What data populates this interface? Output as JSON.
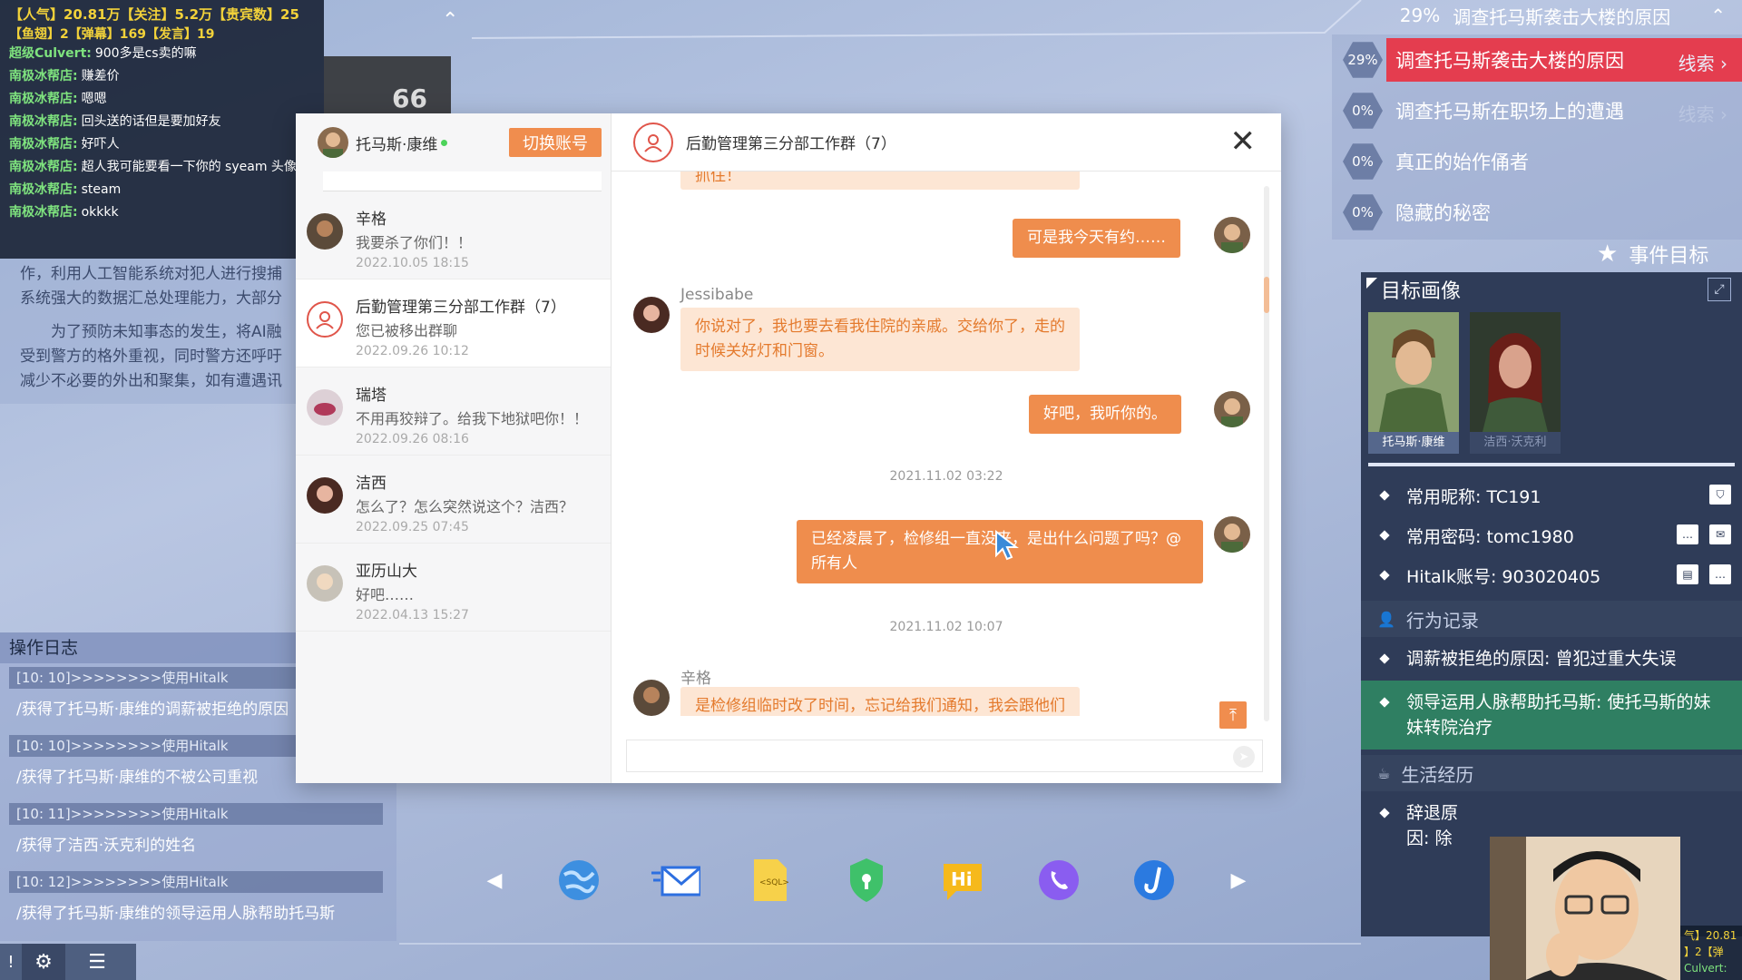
{
  "stream": {
    "stat_line_1": "【人气】20.81万【关注】5.2万【贵宾数】25",
    "stat_line_2": "【鱼翅】2【弹幕】169【发言】19",
    "messages": [
      {
        "user": "超级Culvert:",
        "text": "900多是cs卖的嘛"
      },
      {
        "user": "南极冰帮店:",
        "text": "赚差价"
      },
      {
        "user": "南极冰帮店:",
        "text": "嗯嗯"
      },
      {
        "user": "南极冰帮店:",
        "text": "回头送的话但是要加好友"
      },
      {
        "user": "南极冰帮店:",
        "text": "好吓人"
      },
      {
        "user": "南极冰帮店:",
        "text": "超人我可能要看一下你的 syeam 头像"
      },
      {
        "user": "南极冰帮店:",
        "text": "steam"
      },
      {
        "user": "南极冰帮店:",
        "text": "okkkk"
      }
    ]
  },
  "left_doc": {
    "p1": "作，利用人工智能系统对犯人进行搜捕系统强大的数据汇总处理能力，大部分",
    "p2": "为了预防未知事态的发生，将AI融受到警方的格外重视，同时警方还呼吁减少不必要的外出和聚集，如有遭遇讯"
  },
  "oplog": {
    "title": "操作日志",
    "entries": [
      {
        "time": "[10: 10]>>>>>>>>使用Hitalk",
        "text": "/获得了托马斯·康维的调薪被拒绝的原因"
      },
      {
        "time": "[10: 10]>>>>>>>>使用Hitalk",
        "text": "/获得了托马斯·康维的不被公司重视"
      },
      {
        "time": "[10: 11]>>>>>>>>使用Hitalk",
        "text": "/获得了洁西·沃克利的姓名"
      },
      {
        "time": "[10: 12]>>>>>>>>使用Hitalk",
        "text": "/获得了托马斯·康维的领导运用人脉帮助托马斯"
      }
    ]
  },
  "chat": {
    "account_name": "托马斯·康维",
    "switch_label": "切换账号",
    "group_title": "后勤管理第三分部工作群（7）",
    "conversations": [
      {
        "name": "辛格",
        "last": "我要杀了你们！！",
        "time": "2022.10.05 18:15"
      },
      {
        "name": "后勤管理第三分部工作群（7）",
        "last": "您已被移出群聊",
        "time": "2022.09.26 10:12"
      },
      {
        "name": "瑞塔",
        "last": "不用再狡辩了。给我下地狱吧你！！",
        "time": "2022.09.26 08:16"
      },
      {
        "name": "洁西",
        "last": "怎么了？怎么突然说这个？洁西？",
        "time": "2022.09.25 07:45"
      },
      {
        "name": "亚历山大",
        "last": "好吧……",
        "time": "2022.04.13 15:27"
      }
    ],
    "messages": {
      "top_partial": "抓住！",
      "out1": "可是我今天有约……",
      "sender_jessibabe": "Jessibabe",
      "in1": "你说对了，我也要去看我住院的亲戚。交给你了，走的时候关好灯和门窗。",
      "out2": "好吧，我听你的。",
      "time1": "2021.11.02 03:22",
      "out3": "已经凌晨了，检修组一直没来，是出什么问题了吗？@所有人",
      "time2": "2021.11.02 10:07",
      "sender_xinge": "辛格",
      "in2": "是检修组临时改了时间，忘记给我们通知，我会跟他们的负责人反映。"
    }
  },
  "objectives": {
    "header_pct": "29%",
    "header_title": "调查托马斯袭击大楼的原因",
    "items": [
      {
        "pct": "29%",
        "label": "调查托马斯袭击大楼的原因",
        "clue": "线索"
      },
      {
        "pct": "0%",
        "label": "调查托马斯在职场上的遭遇",
        "clue": "线索"
      },
      {
        "pct": "0%",
        "label": "真正的始作俑者"
      },
      {
        "pct": "0%",
        "label": "隐藏的秘密"
      }
    ],
    "event_goal": "事件目标"
  },
  "profile": {
    "title": "目标画像",
    "portraits": [
      "托马斯·康维",
      "洁西·沃克利"
    ],
    "fields": {
      "nickname": "常用昵称: TC191",
      "password": "常用密码: tomc1980",
      "hitalk": "Hitalk账号: 903020405"
    },
    "behavior_title": "行为记录",
    "behavior": [
      "调薪被拒绝的原因: 曾犯过重大失误",
      "领导运用人脉帮助托马斯: 使托马斯的妹妹转院治疗"
    ],
    "life_title": "生活经历",
    "life": [
      "辞退原因: 除"
    ]
  },
  "mini_stream": {
    "line1": "气】20.81",
    "line2": "】2【弹",
    "line3": "Culvert:"
  }
}
